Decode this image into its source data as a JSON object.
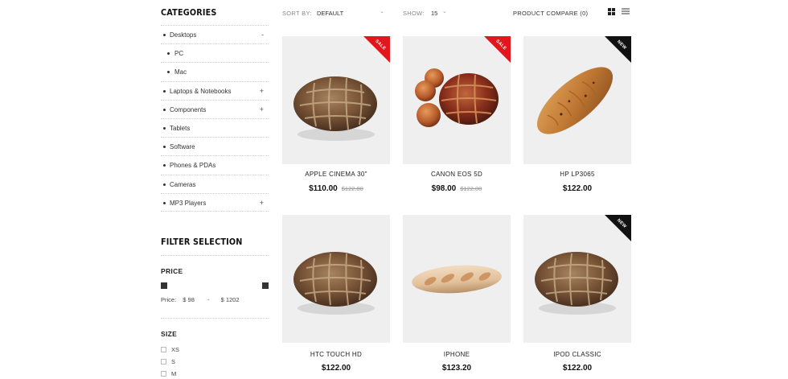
{
  "sidebar": {
    "categories_title": "CATEGORIES",
    "categories": [
      {
        "label": "Desktops",
        "toggle": "-"
      },
      {
        "label": "PC",
        "toggle": ""
      },
      {
        "label": "Mac",
        "toggle": ""
      },
      {
        "label": "Laptops & Notebooks",
        "toggle": "+"
      },
      {
        "label": "Components",
        "toggle": "+"
      },
      {
        "label": "Tablets",
        "toggle": ""
      },
      {
        "label": "Software",
        "toggle": ""
      },
      {
        "label": "Phones & PDAs",
        "toggle": ""
      },
      {
        "label": "Cameras",
        "toggle": ""
      },
      {
        "label": "MP3 Players",
        "toggle": "+"
      }
    ],
    "filter_title": "FILTER SELECTION",
    "price": {
      "title": "PRICE",
      "label": "Price:",
      "min": "$ 98",
      "separator": "-",
      "max": "$ 1202"
    },
    "size": {
      "title": "SIZE",
      "options": [
        "XS",
        "S",
        "M"
      ]
    }
  },
  "toolbar": {
    "sort_label": "SORT BY:",
    "sort_value": "DEFAULT",
    "show_label": "SHOW:",
    "show_value": "15",
    "compare": "PRODUCT COMPARE (0)"
  },
  "products": [
    {
      "name": "APPLE CINEMA 30\"",
      "price": "$110.00",
      "old_price": "$122.00",
      "badge": "SALE",
      "image": "round-bread"
    },
    {
      "name": "CANON EOS 5D",
      "price": "$98.00",
      "old_price": "$122.00",
      "badge": "SALE",
      "image": "bread-with-rolls"
    },
    {
      "name": "HP LP3065",
      "price": "$122.00",
      "old_price": "",
      "badge": "NEW",
      "image": "long-loaf"
    },
    {
      "name": "HTC TOUCH HD",
      "price": "$122.00",
      "old_price": "",
      "badge": "",
      "image": "round-bread"
    },
    {
      "name": "IPHONE",
      "price": "$123.20",
      "old_price": "",
      "badge": "",
      "image": "baguette"
    },
    {
      "name": "IPOD CLASSIC",
      "price": "$122.00",
      "old_price": "",
      "badge": "NEW",
      "image": "round-bread"
    }
  ],
  "colors": {
    "sale": "#e2161c",
    "new": "#111111",
    "image_bg": "#efefef"
  }
}
